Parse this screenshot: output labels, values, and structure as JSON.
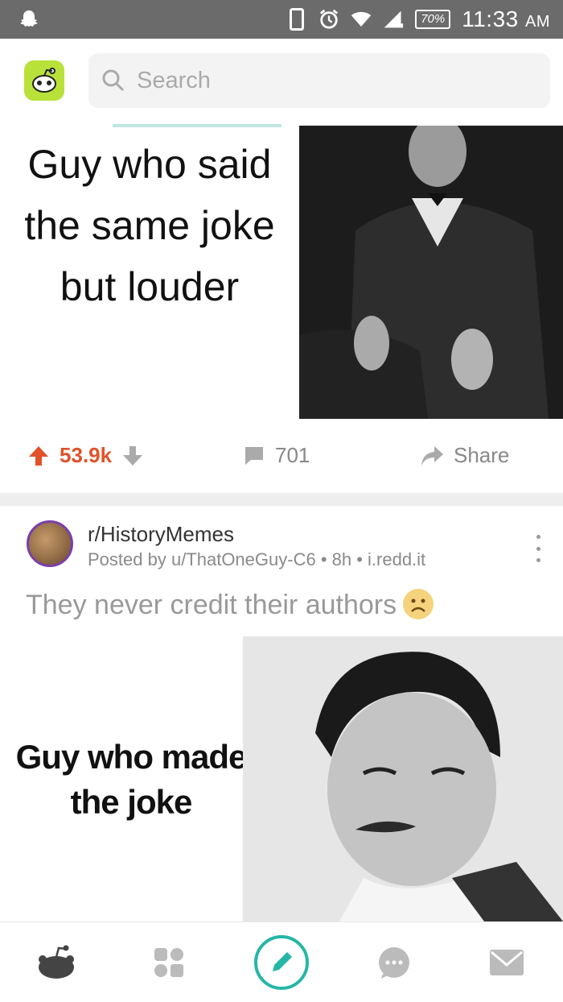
{
  "status_bar": {
    "battery": "70%",
    "time": "11:33",
    "ampm": "AM"
  },
  "search": {
    "placeholder": "Search"
  },
  "post1": {
    "meme_text": "Guy who said the same joke but louder",
    "votes": "53.9k",
    "comments": "701",
    "share": "Share"
  },
  "post2": {
    "subreddit": "r/HistoryMemes",
    "meta": "Posted by u/ThatOneGuy-C6 • 8h • i.redd.it",
    "title": "They never credit their authors",
    "meme_text": "Guy who made the joke"
  },
  "colors": {
    "upvote": "#e0522a",
    "accent_teal": "#26b6a8",
    "logo_green": "#b8e13a"
  }
}
